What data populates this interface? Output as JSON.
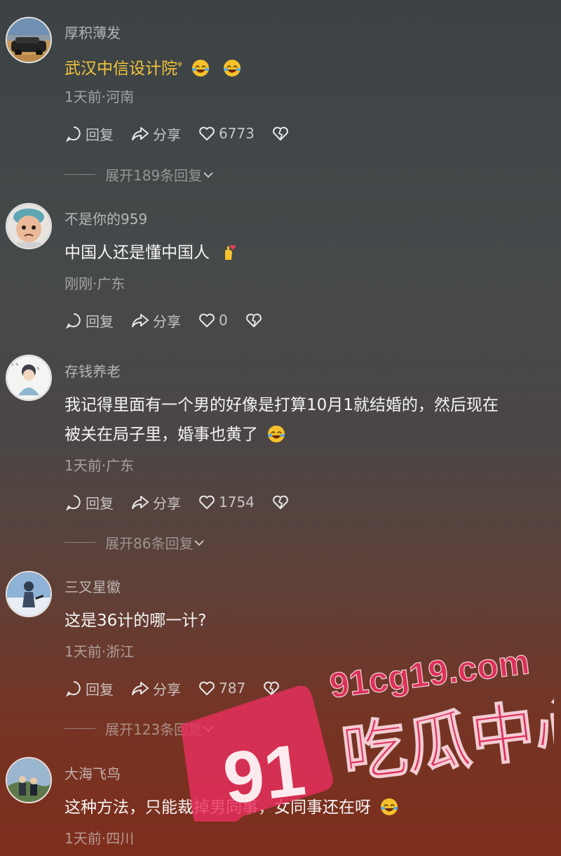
{
  "comments": [
    {
      "author": "厚积薄发",
      "text": "武汉中信设计院",
      "search_mark": "ᵠ",
      "emojis": [
        "laugh-cry-emoji",
        "laugh-cry-emoji"
      ],
      "meta": "1天前·河南",
      "reply_label": "回复",
      "share_label": "分享",
      "likes": "6773",
      "expand_label": "展开189条回复",
      "text_color": "#f3c43b"
    },
    {
      "author": "不是你的959",
      "text": "中国人还是懂中国人",
      "emojis": [
        "hand-heart-emoji"
      ],
      "meta": "刚刚·广东",
      "reply_label": "回复",
      "share_label": "分享",
      "likes": "0"
    },
    {
      "author": "存钱养老",
      "text_line1": "我记得里面有一个男的好像是打算10月1就结婚的，然后现在",
      "text_line2": "被关在局子里，婚事也黄了",
      "emojis": [
        "laugh-cry-emoji"
      ],
      "meta": "1天前·广东",
      "reply_label": "回复",
      "share_label": "分享",
      "likes": "1754",
      "expand_label": "展开86条回复"
    },
    {
      "author": "三叉星徽",
      "text": "这是36计的哪一计?",
      "meta": "1天前·浙江",
      "reply_label": "回复",
      "share_label": "分享",
      "likes": "787",
      "expand_label": "展开123条回复"
    },
    {
      "author": "大海飞鸟",
      "text": "这种方法，只能裁掉男同事，女同事还在呀",
      "emojis": [
        "laugh-cry-emoji"
      ],
      "meta": "1天前·四川"
    }
  ],
  "watermark": {
    "domain": "91cg19.com",
    "badge": "91",
    "slogan": "吃瓜中心",
    "color": "#e8305e"
  }
}
